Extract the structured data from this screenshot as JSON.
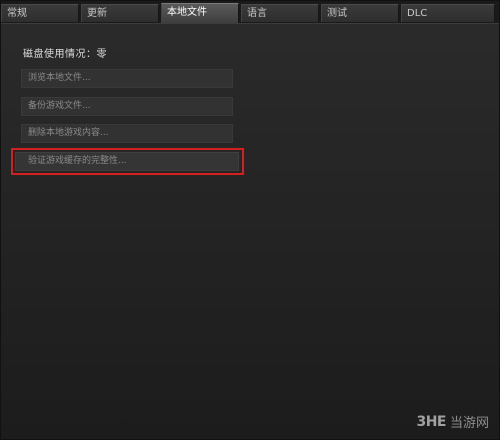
{
  "tabs": [
    {
      "label": "常规",
      "active": false
    },
    {
      "label": "更新",
      "active": false
    },
    {
      "label": "本地文件",
      "active": true
    },
    {
      "label": "语言",
      "active": false
    },
    {
      "label": "测试",
      "active": false
    },
    {
      "label": "DLC",
      "active": false
    }
  ],
  "disk_usage": {
    "label": "磁盘使用情况：零"
  },
  "actions": {
    "browse": "浏览本地文件...",
    "backup": "备份游戏文件...",
    "delete": "删除本地游戏内容...",
    "verify": "验证游戏缓存的完整性..."
  },
  "highlight_color": "#d41f1f",
  "watermark": {
    "logo": "3HE",
    "text": "当游网"
  }
}
